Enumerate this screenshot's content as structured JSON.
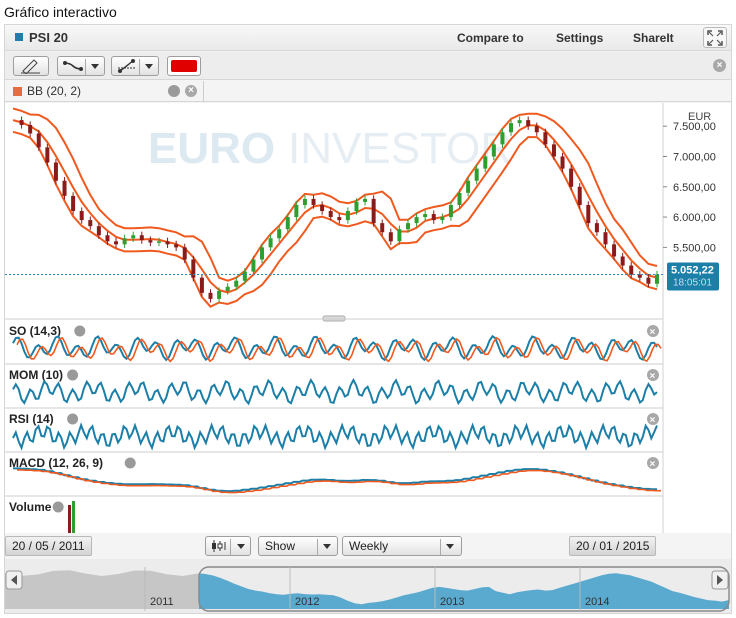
{
  "page_title": "Gráfico interactivo",
  "header": {
    "instrument": "PSI 20",
    "menu": [
      "Compare to",
      "Settings",
      "ShareIt"
    ]
  },
  "indicator_tab": {
    "label": "BB (20, 2)"
  },
  "watermark": {
    "part1": "EURO",
    "part2": "INVESTOR"
  },
  "colors": {
    "price_up": "#2e9e2e",
    "price_down": "#8b1a1a",
    "bollinger": "#f05a1e",
    "indicator": "#1b7fa8",
    "last_price_bg": "#1b7fa8",
    "navigator_fill": "#5aa9cf"
  },
  "chart_data": {
    "type": "line",
    "currency": "EUR",
    "interval": "Weekly",
    "yticks": [
      "7.500,00",
      "7.000,00",
      "6.500,00",
      "6.000,00",
      "5.500,00"
    ],
    "ytick_values": [
      7500,
      7000,
      6500,
      6000,
      5500
    ],
    "ylim": [
      4450,
      7800
    ],
    "last_price": {
      "label": "5.052,22",
      "value": 5052.22,
      "time": "18:05:01"
    },
    "series": [
      {
        "values": [
          7600,
          7520,
          7380,
          7150,
          6900,
          6600,
          6350,
          6100,
          5950,
          5850,
          5700,
          5600,
          5550,
          5650,
          5700,
          5620,
          5580,
          5600,
          5550,
          5500,
          5300,
          5000,
          4750,
          4650,
          4780,
          4850,
          4950,
          5100,
          5300,
          5500,
          5650,
          5800,
          6000,
          6200,
          6300,
          6200,
          6100,
          6000,
          5950,
          6100,
          6250,
          6300,
          5900,
          5750,
          5600,
          5800,
          5900,
          6000,
          6050,
          5950,
          6000,
          6200,
          6400,
          6600,
          6800,
          7000,
          7200,
          7400,
          7550,
          7600,
          7500,
          7400,
          7200,
          7000,
          6800,
          6500,
          6200,
          5900,
          5750,
          5550,
          5350,
          5200,
          5050,
          5000,
          4900,
          5052
        ]
      }
    ],
    "date_start": "20 / 05 / 2011",
    "date_end": "20 / 01 / 2015",
    "navigator_years": [
      "2011",
      "2012",
      "2013",
      "2014"
    ]
  },
  "panels": [
    {
      "label": "SO (14,3)"
    },
    {
      "label": "MOM (10)"
    },
    {
      "label": "RSI (14)"
    },
    {
      "label": "MACD (12, 26, 9)"
    },
    {
      "label": "Volume"
    }
  ],
  "controls": {
    "show_label": "Show",
    "interval_label": "Weekly"
  }
}
